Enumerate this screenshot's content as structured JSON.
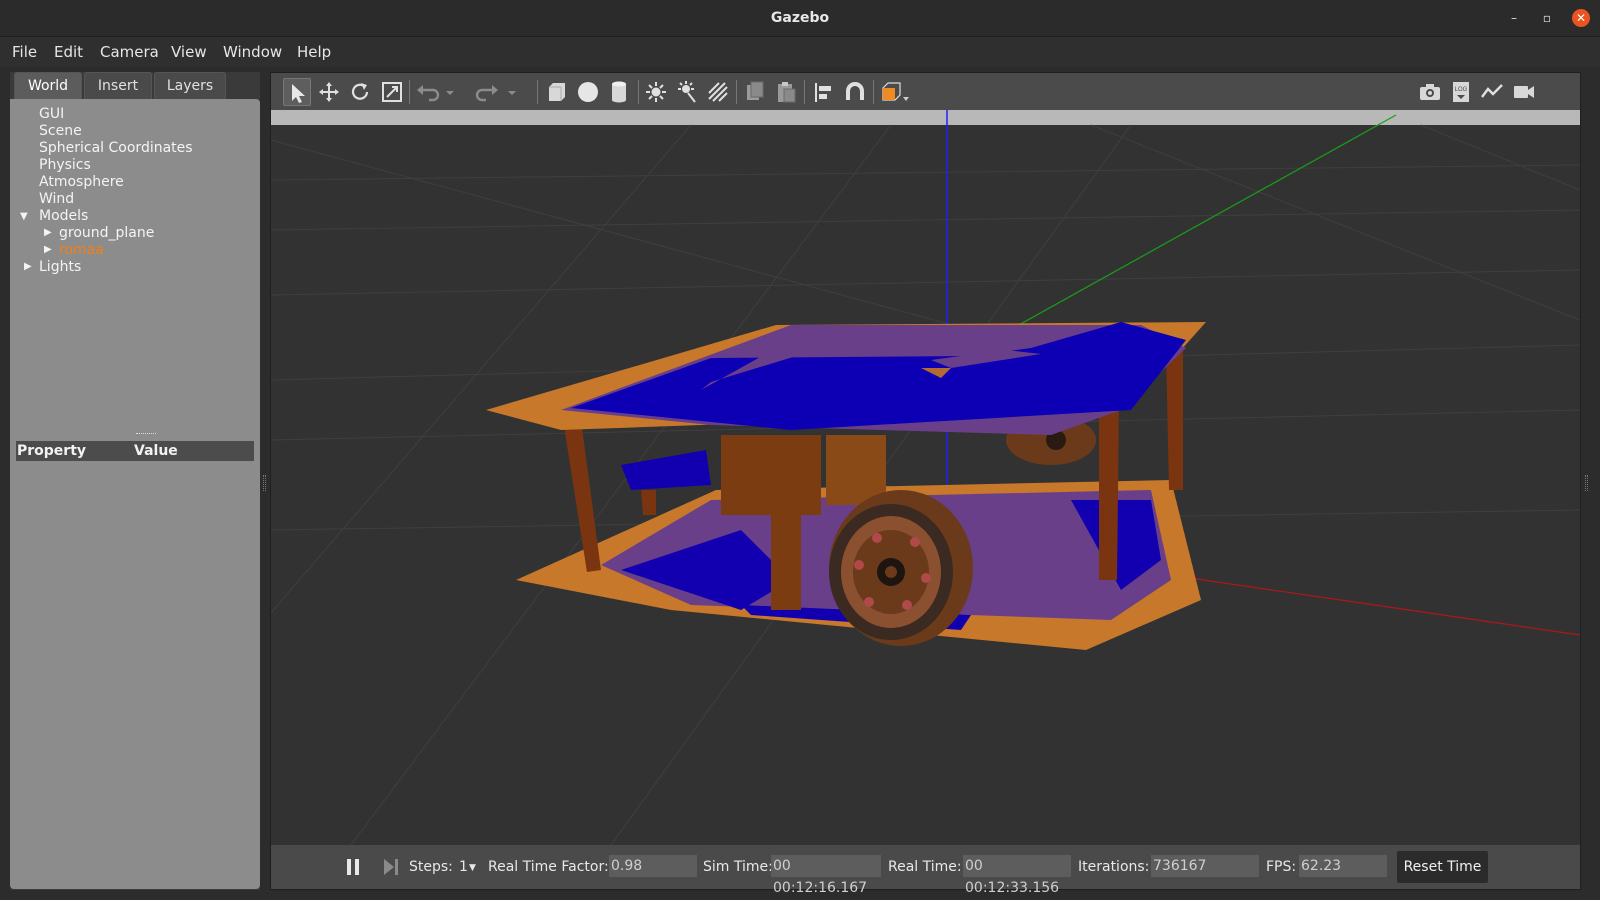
{
  "window": {
    "title": "Gazebo"
  },
  "menu": {
    "items": [
      "File",
      "Edit",
      "Camera",
      "View",
      "Window",
      "Help"
    ]
  },
  "left_panel": {
    "tabs": [
      "World",
      "Insert",
      "Layers"
    ],
    "tree": [
      "GUI",
      "Scene",
      "Spherical Coordinates",
      "Physics",
      "Atmosphere",
      "Wind",
      "Models",
      "ground_plane",
      "romaa",
      "Lights"
    ],
    "property_header": {
      "property": "Property",
      "value": "Value"
    }
  },
  "toolbar": {
    "left_icons": [
      "select-arrow-icon",
      "translate-icon",
      "rotate-icon",
      "scale-icon",
      "undo-icon",
      "redo-icon",
      "box-icon",
      "sphere-icon",
      "cylinder-icon",
      "point-light-icon",
      "spot-light-icon",
      "directional-light-icon",
      "copy-icon",
      "paste-icon",
      "align-icon",
      "snap-magnet-icon",
      "view-angle-icon"
    ],
    "right_icons": [
      "screenshot-icon",
      "log-icon",
      "plot-icon",
      "record-video-icon"
    ]
  },
  "status": {
    "steps_label": "Steps:",
    "steps_value": "1",
    "rtf_label": "Real Time Factor:",
    "rtf_value": "0.98",
    "sim_time_label": "Sim Time:",
    "sim_time_value": "00 00:12:16.167",
    "real_time_label": "Real Time:",
    "real_time_value": "00 00:12:33.156",
    "iterations_label": "Iterations:",
    "iterations_value": "736167",
    "fps_label": "FPS:",
    "fps_value": "62.23",
    "reset_label": "Reset Time"
  },
  "colors": {
    "accent": "#e95420",
    "selected_model": "#f0801a",
    "robot_orange": "#d07a2a",
    "robot_blue": "#0a00a8"
  }
}
